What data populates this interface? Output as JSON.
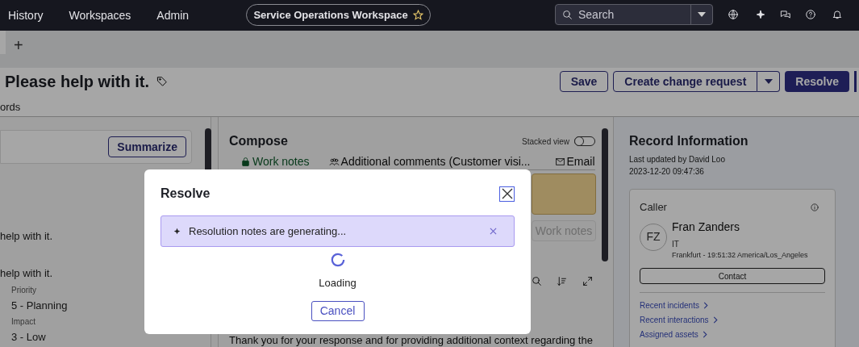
{
  "nav": {
    "items": [
      "History",
      "Workspaces",
      "Admin"
    ],
    "workspace": "Service Operations Workspace",
    "search": {
      "placeholder": "Search"
    }
  },
  "tabs": {
    "add": "+"
  },
  "record": {
    "title": "Please help with it.",
    "actions": [
      {
        "label": "Save",
        "kind": "outline"
      },
      {
        "label": "Create change request",
        "kind": "split"
      },
      {
        "label": "Resolve",
        "kind": "primary"
      }
    ],
    "subtab": "ords"
  },
  "left": {
    "summarize": "Summarize",
    "lines": [
      "help with it.",
      "help with it."
    ],
    "fields": [
      {
        "label": "Priority",
        "value": "5 - Planning"
      },
      {
        "label": "Impact",
        "value": "3 - Low"
      }
    ]
  },
  "compose": {
    "title": "Compose",
    "stacked_view": {
      "label": "Stacked view",
      "on": false
    },
    "tabs": [
      {
        "label": "Work notes",
        "selected": true
      },
      {
        "label": "Additional comments (Customer visi...",
        "selected": false
      },
      {
        "label": "Email",
        "selected": false
      }
    ],
    "post_button": {
      "label": "Work notes",
      "disabled": true
    },
    "message": "Thank you for your response and for providing additional context regarding the"
  },
  "record_info": {
    "title": "Record Information",
    "updated": "Last updated by David Loo",
    "date": "2023-12-20 09:47:36",
    "caller": {
      "heading": "Caller",
      "initials": "FZ",
      "name": "Fran Zanders",
      "department": "IT",
      "location": "Frankfurt - 19:51:32 America/Los_Angeles",
      "contact": "Contact"
    },
    "links": [
      "Recent incidents",
      "Recent interactions",
      "Assigned assets"
    ]
  },
  "modal": {
    "title": "Resolve",
    "banner": "Resolution notes are generating...",
    "loading": "Loading",
    "cancel": "Cancel"
  }
}
